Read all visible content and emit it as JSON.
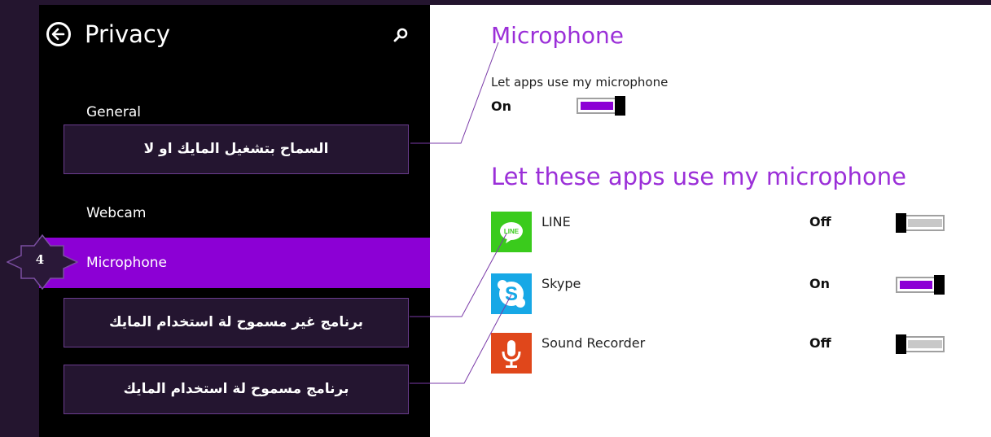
{
  "left_pane": {
    "title": "Privacy",
    "nav": [
      {
        "label": "General"
      },
      {
        "label": "Webcam"
      },
      {
        "label": "Microphone",
        "selected": true
      }
    ],
    "icons": {
      "back": "back-arrow-icon",
      "search": "search-icon"
    }
  },
  "annotations": {
    "badge_number": "4",
    "callouts": [
      "السماح بتشغيل المايك او لا",
      "برنامج غير مسموح لة استخدام المايك",
      "برنامج مسموح لة استخدام المايك"
    ]
  },
  "right_pane": {
    "heading": "Microphone",
    "master": {
      "label": "Let apps use my microphone",
      "state": "On"
    },
    "apps_heading": "Let these apps use my microphone",
    "apps": [
      {
        "name": "LINE",
        "state": "Off",
        "icon": "line-app-icon",
        "color": "#3acb1c"
      },
      {
        "name": "Skype",
        "state": "On",
        "icon": "skype-app-icon",
        "color": "#17a8e6"
      },
      {
        "name": "Sound Recorder",
        "state": "Off",
        "icon": "sound-recorder-icon",
        "color": "#e0471b"
      }
    ]
  },
  "colors": {
    "accent": "#8c00d5",
    "heading": "#9b2fd8",
    "frame": "#24152f",
    "pane_bg": "#000000"
  }
}
